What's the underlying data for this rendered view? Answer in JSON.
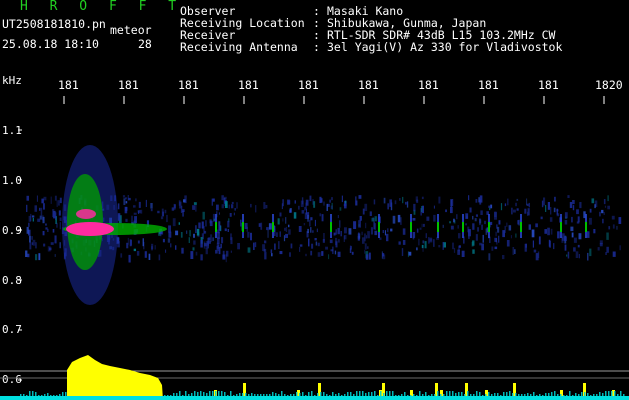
{
  "app": {
    "title": "H R O F F T"
  },
  "info": {
    "filename": "UT2508181810.pn",
    "event_type": "meteor",
    "datetime": "25.08.18 18:10",
    "count": "28"
  },
  "header": {
    "observer_label": "Observer",
    "observer_value": "Masaki Kano",
    "location_label": "Receiving Location",
    "location_value": "Shibukawa, Gunma, Japan",
    "receiver_label": "Receiver",
    "receiver_value": "RTL-SDR SDR# 43dB L15 103.2MHz CW",
    "antenna_label": "Receiving Antenna",
    "antenna_value": "3el Yagi(V) Az 330 for Vladivostok",
    "separator": ":"
  },
  "axis": {
    "unit": "kHz",
    "x_ticks": [
      "181",
      "181",
      "181",
      "181",
      "181",
      "181",
      "181",
      "181",
      "181",
      "1820"
    ],
    "y_ticks": [
      "1.1",
      "1.0",
      "0.9",
      "0.8",
      "0.7",
      "0.6"
    ]
  },
  "colors": {
    "background": "#000000",
    "title": "#22d022",
    "signal_strong": "#ff2aa0",
    "signal_mid": "#00c000",
    "signal_low": "#1a2a9a",
    "level_bar": "#ffff00",
    "level_baseline": "#00ffff"
  }
}
